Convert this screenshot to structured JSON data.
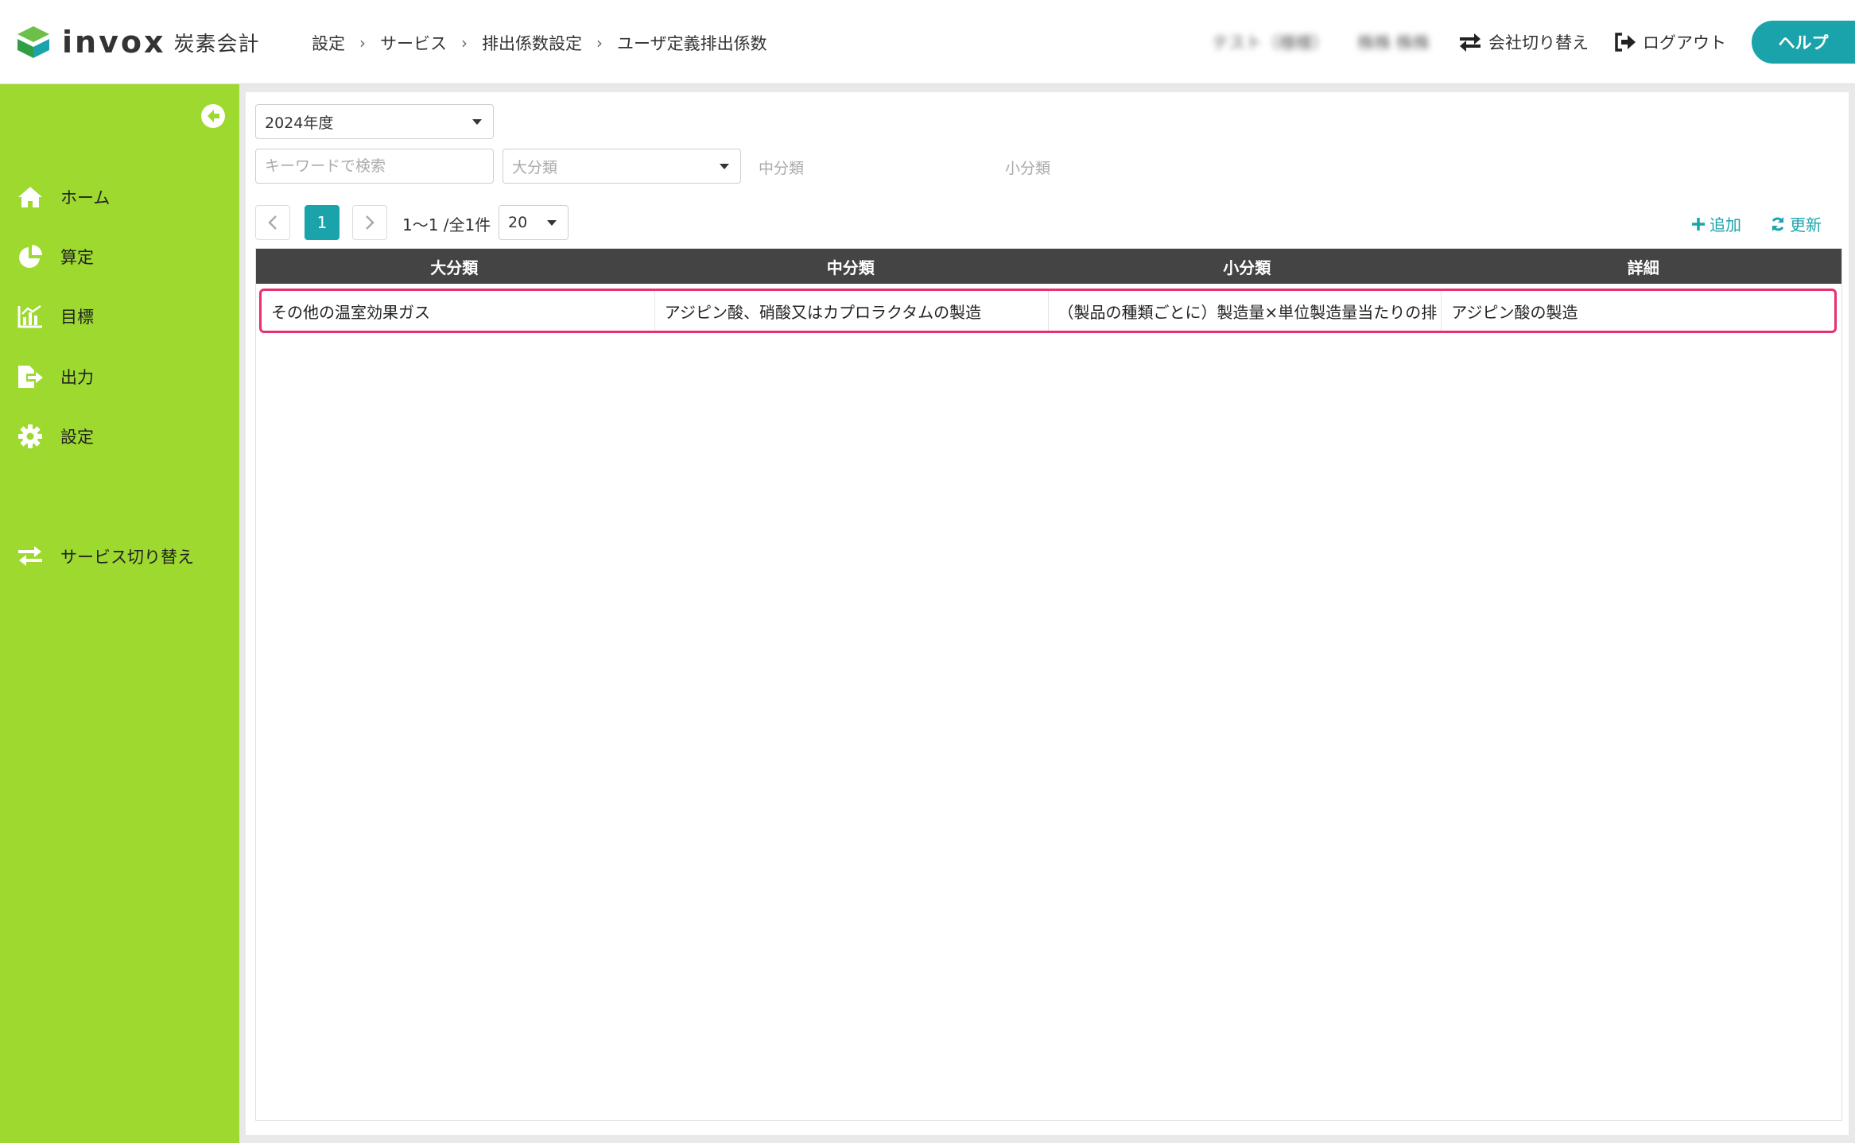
{
  "app": {
    "logo_word": "invox",
    "logo_sub": "炭素会計"
  },
  "breadcrumb": [
    "設定",
    "サービス",
    "排出係数設定",
    "ユーザ定義排出係数"
  ],
  "header": {
    "blurred_user": "テスト（様様）",
    "blurred_company": "株株 株株",
    "switch_company": "会社切り替え",
    "logout": "ログアウト",
    "help": "ヘルプ"
  },
  "sidebar": {
    "items": [
      {
        "label": "ホーム",
        "icon": "home-icon"
      },
      {
        "label": "算定",
        "icon": "pie-chart-icon"
      },
      {
        "label": "目標",
        "icon": "target-chart-icon"
      },
      {
        "label": "出力",
        "icon": "export-icon"
      },
      {
        "label": "設定",
        "icon": "gear-icon"
      },
      {
        "label": "サービス切り替え",
        "icon": "switch-icon"
      }
    ]
  },
  "filters": {
    "year": "2024年度",
    "keyword_placeholder": "キーワードで検索",
    "major_placeholder": "大分類",
    "middle_label": "中分類",
    "minor_label": "小分類"
  },
  "pagination": {
    "current_page": "1",
    "range_text": "1〜1 /全1件",
    "per_page": "20"
  },
  "actions": {
    "add": "追加",
    "refresh": "更新"
  },
  "table": {
    "columns": [
      "大分類",
      "中分類",
      "小分類",
      "詳細"
    ],
    "rows": [
      [
        "その他の温室効果ガス",
        "アジピン酸、硝酸又はカプロラクタムの製造",
        "（製品の種類ごとに）製造量×単位製造量当たりの排",
        "アジピン酸の製造"
      ]
    ]
  },
  "colors": {
    "sidebar": "#9dd92f",
    "accent": "#1aa3aa",
    "table_header": "#444444",
    "row_highlight": "#e8306c"
  }
}
